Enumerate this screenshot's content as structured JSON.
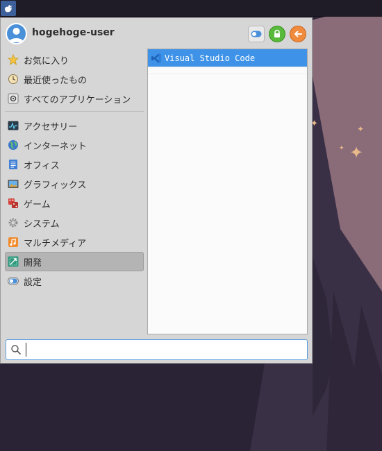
{
  "user": {
    "name": "hogehoge-user"
  },
  "header_buttons": [
    {
      "icon": "settings-toggle-icon"
    },
    {
      "icon": "lock-icon"
    },
    {
      "icon": "logout-arrow-icon"
    }
  ],
  "categories_top": [
    {
      "label": "お気に入り",
      "icon": "star-icon"
    },
    {
      "label": "最近使ったもの",
      "icon": "recent-clock-icon"
    },
    {
      "label": "すべてのアプリケーション",
      "icon": "all-apps-icon"
    }
  ],
  "categories": [
    {
      "label": "アクセサリー",
      "icon": "accessories-icon"
    },
    {
      "label": "インターネット",
      "icon": "globe-icon"
    },
    {
      "label": "オフィス",
      "icon": "office-document-icon"
    },
    {
      "label": "グラフィックス",
      "icon": "graphics-image-icon"
    },
    {
      "label": "ゲーム",
      "icon": "dice-icon"
    },
    {
      "label": "システム",
      "icon": "system-gear-icon"
    },
    {
      "label": "マルチメディア",
      "icon": "music-note-icon"
    },
    {
      "label": "開発",
      "icon": "development-icon",
      "selected": true
    },
    {
      "label": "設定",
      "icon": "settings-icon"
    }
  ],
  "apps": [
    {
      "label": "Visual Studio Code",
      "icon": "vscode-icon"
    }
  ],
  "search": {
    "value": "",
    "placeholder": ""
  },
  "colors": {
    "selection": "#3e93e8",
    "menu_bg": "#d6d6d6",
    "desktop_bg": "#2a2336",
    "moon": "#8a6b78"
  }
}
